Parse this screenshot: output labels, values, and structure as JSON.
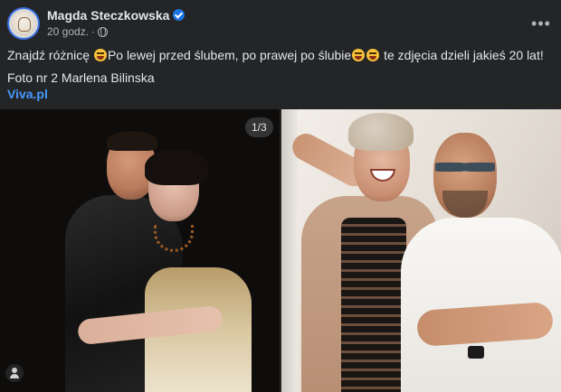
{
  "post": {
    "author": "Magda Steczkowska",
    "timestamp": "20 godz.",
    "separator": "·",
    "more_label": "•••",
    "text_line1_a": "Znajdź różnicę ",
    "text_line1_b": "Po lewej przed ślubem, po prawej po ślubie",
    "text_line1_c": " te zdjęcia dzieli jakieś 20 lat!",
    "text_line2": "Foto nr 2 Marlena Bilinska",
    "link": "Viva.pl"
  },
  "media": {
    "counter": "1/3"
  },
  "icons": {
    "verified": "verified-badge-icon",
    "privacy": "globe-icon",
    "more": "more-options-icon",
    "emoji": "laughing-emoji-icon",
    "tag": "tag-person-icon"
  },
  "colors": {
    "background": "#242526",
    "text": "#e4e6eb",
    "secondary": "#b0b3b8",
    "link": "#4599ff",
    "verified": "#1b74e4"
  }
}
